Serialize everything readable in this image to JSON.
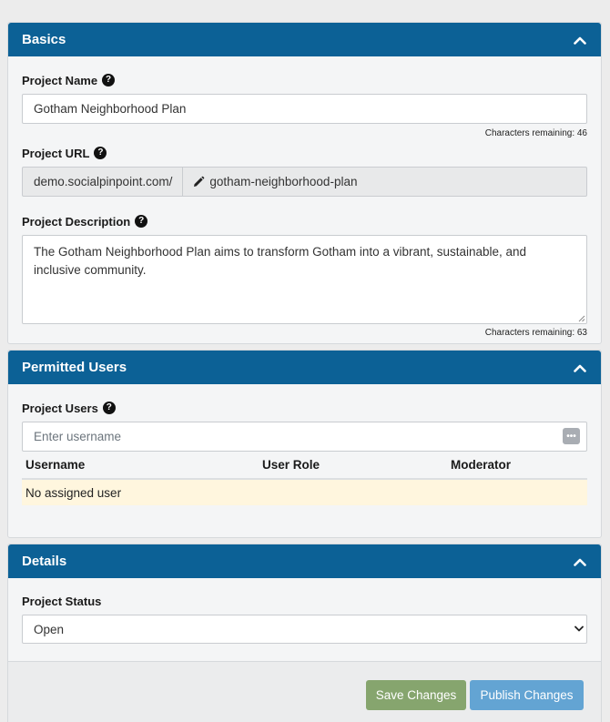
{
  "basics": {
    "title": "Basics",
    "project_name": {
      "label": "Project Name",
      "value": "Gotham Neighborhood Plan",
      "chars_remaining": "Characters remaining: 46"
    },
    "project_url": {
      "label": "Project URL",
      "prefix": "demo.socialpinpoint.com/",
      "slug": "gotham-neighborhood-plan"
    },
    "project_description": {
      "label": "Project Description",
      "value": "The Gotham Neighborhood Plan aims to transform Gotham into a vibrant, sustainable, and inclusive community.",
      "chars_remaining": "Characters remaining: 63"
    }
  },
  "permitted_users": {
    "title": "Permitted Users",
    "label": "Project Users",
    "placeholder": "Enter username",
    "ellipsis": "•••",
    "columns": [
      "Username",
      "User Role",
      "Moderator"
    ],
    "empty_message": "No assigned user"
  },
  "details": {
    "title": "Details",
    "status_label": "Project Status",
    "status_value": "Open"
  },
  "footer": {
    "save_label": "Save Changes",
    "publish_label": "Publish Changes"
  },
  "icons": {
    "help": "question-circle-icon",
    "collapse": "chevron-up-icon",
    "edit": "pencil-icon",
    "more": "ellipsis-icon"
  },
  "colors": {
    "header": "#0c6196",
    "save_button": "#86a56e",
    "publish_button": "#63a4d3",
    "empty_row": "#fff6de"
  }
}
